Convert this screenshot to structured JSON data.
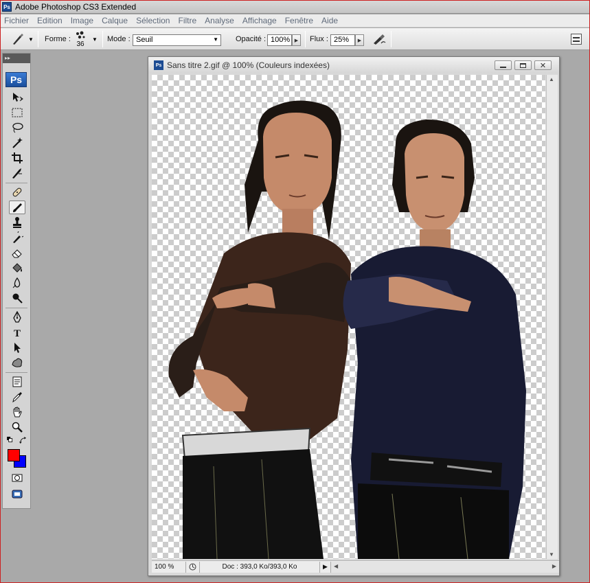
{
  "window": {
    "title": "Adobe Photoshop CS3 Extended",
    "icon_label": "Ps"
  },
  "menu": [
    "Fichier",
    "Edition",
    "Image",
    "Calque",
    "Sélection",
    "Filtre",
    "Analyse",
    "Affichage",
    "Fenêtre",
    "Aide"
  ],
  "options": {
    "forme_label": "Forme :",
    "brush_size": "36",
    "mode_label": "Mode :",
    "mode_value": "Seuil",
    "opacite_label": "Opacité :",
    "opacite_value": "100%",
    "flux_label": "Flux :",
    "flux_value": "25%"
  },
  "toolbox": {
    "logo": "Ps",
    "grip": "▸▸",
    "tools": [
      "move-tool",
      "marquee-tool",
      "lasso-tool",
      "magic-wand-tool",
      "crop-tool",
      "slice-tool",
      "healing-brush-tool",
      "brush-tool",
      "clone-stamp-tool",
      "history-brush-tool",
      "eraser-tool",
      "paint-bucket-tool",
      "blur-tool",
      "dodge-tool",
      "pen-tool",
      "type-tool",
      "path-selection-tool",
      "custom-shape-tool",
      "notes-tool",
      "eyedropper-tool",
      "hand-tool",
      "zoom-tool"
    ],
    "active_tool": "brush-tool",
    "foreground_color": "#ff0000",
    "background_color": "#0000ff"
  },
  "document": {
    "title": "Sans titre 2.gif @ 100% (Couleurs indexées)",
    "icon_label": "Ps",
    "zoom": "100 %",
    "doc_info": "Doc : 393,0 Ko/393,0 Ko"
  },
  "colors": {
    "accent_red": "#cc1f1f",
    "workspace": "#a9a9a9"
  }
}
